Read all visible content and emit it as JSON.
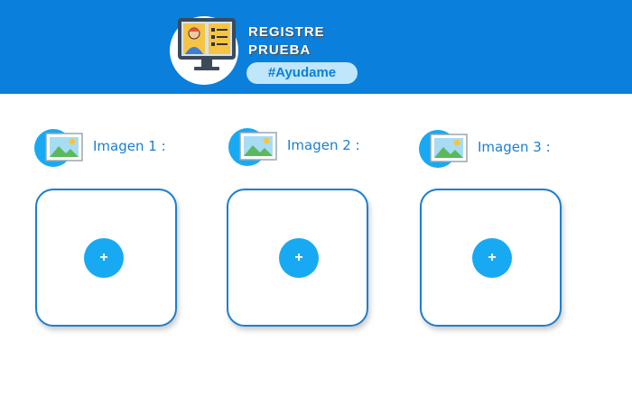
{
  "header": {
    "title_line1": "REGISTRE",
    "title_line2": "PRUEBA",
    "hashtag": "#Ayudame",
    "logo_icon": "computer-user-icon",
    "background": "#0a7fdc"
  },
  "slots": [
    {
      "label": "Imagen 1 :",
      "add_label": "+"
    },
    {
      "label": "Imagen 2 :",
      "add_label": "+"
    },
    {
      "label": "Imagen 3 :",
      "add_label": "+"
    }
  ],
  "colors": {
    "accent": "#1a7fd0",
    "button": "#17aaf2"
  }
}
